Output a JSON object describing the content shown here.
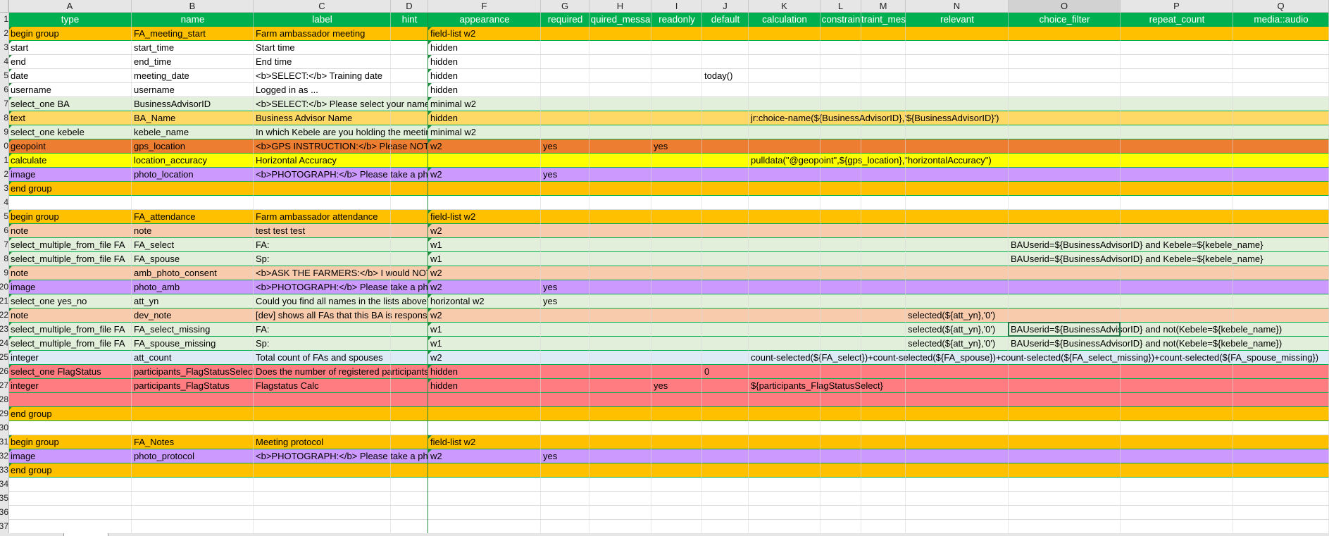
{
  "column_letters": [
    "A",
    "B",
    "C",
    "D",
    "F",
    "G",
    "H",
    "I",
    "J",
    "K",
    "L",
    "M",
    "N",
    "O",
    "P",
    "Q"
  ],
  "selected_column": "O",
  "selected_cell": "O23",
  "header_row": {
    "row_number": "1",
    "cells": [
      "type",
      "name",
      "label",
      "hint",
      "appearance",
      "required",
      "quired_messa",
      "readonly",
      "default",
      "calculation",
      "constrain",
      "traint_mes",
      "relevant",
      "choice_filter",
      "repeat_count",
      "media::audio"
    ]
  },
  "rows": [
    {
      "num": "2",
      "band": "orange",
      "cells": {
        "A": "begin group",
        "B": "FA_meeting_start",
        "C": "Farm ambassador meeting",
        "F": "field-list w2"
      }
    },
    {
      "num": "3",
      "band": "white",
      "cells": {
        "A": "start",
        "B": "start_time",
        "C": "Start time",
        "F": "hidden"
      }
    },
    {
      "num": "4",
      "band": "white",
      "cells": {
        "A": "end",
        "B": "end_time",
        "C": "End time",
        "F": "hidden"
      }
    },
    {
      "num": "5",
      "band": "white",
      "cells": {
        "A": "date",
        "B": "meeting_date",
        "C": "<b>SELECT:</b> Training date",
        "F": "hidden",
        "J": "today()"
      }
    },
    {
      "num": "6",
      "band": "white",
      "cells": {
        "A": "username",
        "B": "username",
        "C": "Logged in as ...",
        "F": "hidden"
      }
    },
    {
      "num": "7",
      "band": "lightgreen",
      "cells": {
        "A": "select_one BA",
        "B": "BusinessAdvisorID",
        "C": "<b>SELECT:</b> Please select your name",
        "F": "minimal w2"
      }
    },
    {
      "num": "8",
      "band": "lightorange",
      "cells": {
        "A": "text",
        "B": "BA_Name",
        "C": "Business Advisor Name",
        "F": "hidden",
        "K": "jr:choice-name(${BusinessAdvisorID},'${BusinessAdvisorID}')"
      }
    },
    {
      "num": "9",
      "band": "lightgreen",
      "cells": {
        "A": "select_one kebele",
        "B": "kebele_name",
        "C": "In which Kebele are you holding the meeting?",
        "F": "minimal w2"
      }
    },
    {
      "num": "0",
      "band": "darkorange",
      "cells": {
        "A": "geopoint",
        "B": "gps_location",
        "C": "<b>GPS INSTRUCTION:</b> Please NOTE: It",
        "F": "w2",
        "G": "yes",
        "I": "yes"
      }
    },
    {
      "num": "1",
      "band": "yellow",
      "cells": {
        "A": "calculate",
        "B": "location_accuracy",
        "C": "Horizontal Accuracy",
        "K": "pulldata(\"@geopoint\",${gps_location},\"horizontalAccuracy\")"
      }
    },
    {
      "num": "2",
      "band": "purple",
      "cells": {
        "A": "image",
        "B": "photo_location",
        "C": "<b>PHOTOGRAPH:</b> Please take a photo",
        "F": "w2",
        "G": "yes"
      }
    },
    {
      "num": "3",
      "band": "orange",
      "cells": {
        "A": "end group"
      }
    },
    {
      "num": "4",
      "band": "white",
      "cells": {}
    },
    {
      "num": "5",
      "band": "orange",
      "cells": {
        "A": "begin group",
        "B": "FA_attendance",
        "C": "Farm ambassador attendance",
        "F": "field-list w2"
      }
    },
    {
      "num": "6",
      "band": "peach",
      "cells": {
        "A": "note",
        "B": "note",
        "C": "test test test",
        "F": "w2"
      }
    },
    {
      "num": "7",
      "band": "lightgreen",
      "cells": {
        "A": "select_multiple_from_file FA",
        "B": "FA_select",
        "C": "FA:",
        "F": "w1",
        "O": "BAUserid=${BusinessAdvisorID} and Kebele=${kebele_name}"
      }
    },
    {
      "num": "8",
      "band": "lightgreen",
      "cells": {
        "A": "select_multiple_from_file FA",
        "B": "FA_spouse",
        "C": "Sp:",
        "F": "w1",
        "O": "BAUserid=${BusinessAdvisorID} and Kebele=${kebele_name}"
      }
    },
    {
      "num": "9",
      "band": "peach",
      "cells": {
        "A": "note",
        "B": "amb_photo_consent",
        "C": "<b>ASK THE FARMERS:</b>  I would NOTE: Please",
        "F": "w2"
      }
    },
    {
      "num": "20",
      "band": "purple",
      "cells": {
        "A": "image",
        "B": "photo_amb",
        "C": "<b>PHOTOGRAPH:</b> Please take a photo",
        "F": "w2",
        "G": "yes"
      }
    },
    {
      "num": "21",
      "band": "lightgreen",
      "cells": {
        "A": "select_one yes_no",
        "B": "att_yn",
        "C": "Could you find all names in the lists above?",
        "F": "horizontal w2",
        "G": "yes"
      }
    },
    {
      "num": "22",
      "band": "peach",
      "cells": {
        "A": "note",
        "B": "dev_note",
        "C": "[dev] shows all FAs that this BA is responsible",
        "F": "w2",
        "N": "selected(${att_yn},'0')"
      }
    },
    {
      "num": "23",
      "band": "lightgreen",
      "cells": {
        "A": "select_multiple_from_file FA",
        "B": "FA_select_missing",
        "C": "FA:",
        "F": "w1",
        "N": "selected(${att_yn},'0')",
        "O": "BAUserid=${BusinessAdvisorID} and not(Kebele=${kebele_name})"
      }
    },
    {
      "num": "24",
      "band": "lightgreen",
      "cells": {
        "A": "select_multiple_from_file FA",
        "B": "FA_spouse_missing",
        "C": "Sp:",
        "F": "w1",
        "N": "selected(${att_yn},'0')",
        "O": "BAUserid=${BusinessAdvisorID} and not(Kebele=${kebele_name})"
      }
    },
    {
      "num": "25",
      "band": "lightblue",
      "cells": {
        "A": "integer",
        "B": "att_count",
        "C": "Total count of FAs and spouses",
        "F": "w2",
        "K": "count-selected(${FA_select})+count-selected(${FA_spouse})+count-selected(${FA_select_missing})+count-selected(${FA_spouse_missing})"
      }
    },
    {
      "num": "26",
      "band": "red",
      "cells": {
        "A": "select_one FlagStatus",
        "B": "participants_FlagStatusSelect",
        "C": "Does the number of registered participants",
        "F": "hidden",
        "J": "0"
      }
    },
    {
      "num": "27",
      "band": "red",
      "cells": {
        "A": "integer",
        "B": "participants_FlagStatus",
        "C": "Flagstatus Calc",
        "F": "hidden",
        "I": "yes",
        "K": "${participants_FlagStatusSelect}"
      }
    },
    {
      "num": "28",
      "band": "red",
      "cells": {}
    },
    {
      "num": "29",
      "band": "orange",
      "cells": {
        "A": "end group"
      }
    },
    {
      "num": "30",
      "band": "white",
      "cells": {}
    },
    {
      "num": "31",
      "band": "orange",
      "cells": {
        "A": "begin group",
        "B": "FA_Notes",
        "C": "Meeting protocol",
        "F": "field-list w2"
      }
    },
    {
      "num": "32",
      "band": "purple",
      "cells": {
        "A": "image",
        "B": "photo_protocol",
        "C": "<b>PHOTOGRAPH:</b> Please take a photo",
        "F": "w2",
        "G": "yes"
      }
    },
    {
      "num": "33",
      "band": "orange",
      "cells": {
        "A": "end group"
      }
    },
    {
      "num": "34",
      "band": "white",
      "cells": {}
    },
    {
      "num": "35",
      "band": "white",
      "cells": {}
    },
    {
      "num": "36",
      "band": "white",
      "cells": {}
    },
    {
      "num": "37",
      "band": "white",
      "cells": {}
    }
  ],
  "colors": {
    "header_green": "#00b050",
    "orange": "#ffc000",
    "lightorange": "#ffd966",
    "darkorange": "#ed7d31",
    "yellow": "#ffff00",
    "lightgreen": "#e2efda",
    "purple": "#cc99ff",
    "peach": "#f8cbad",
    "lightblue": "#ddebf7",
    "red": "#ff7c80",
    "white": "#ffffff",
    "gridline": "#00b050"
  }
}
